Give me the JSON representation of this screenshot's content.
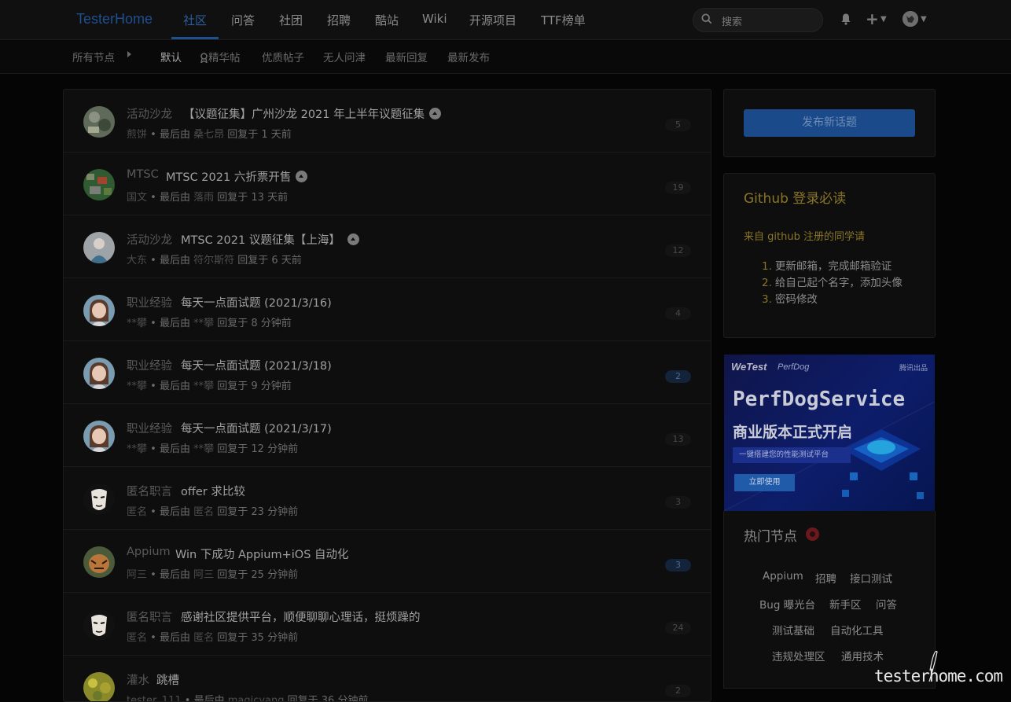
{
  "brand": "TesterHome",
  "nav": [
    "社区",
    "问答",
    "社团",
    "招聘",
    "酷站",
    "Wiki",
    "开源项目",
    "TTF榜单"
  ],
  "search": {
    "placeholder": "搜索"
  },
  "user_menu": {
    "plus": "+"
  },
  "subnav": {
    "all_nodes": "所有节点",
    "tabs": [
      "默认",
      "精华帖",
      "优质帖子",
      "无人问津",
      "最新回复",
      "最新发布"
    ]
  },
  "meta_sep": "• 最后由",
  "topics": [
    {
      "node": "活动沙龙",
      "title": "【议题征集】广州沙龙 2021 年上半年议题征集",
      "author": "煎饼",
      "last_user": "桑七昂",
      "time": "回复于 1 天前",
      "count": "5",
      "pinned": true
    },
    {
      "node": "MTSC",
      "title": "MTSC 2021 六折票开售",
      "author": "国文",
      "last_user": "落雨",
      "time": "回复于 13 天前",
      "count": "19",
      "pinned": true
    },
    {
      "node": "活动沙龙",
      "title": "MTSC 2021 议题征集【上海】",
      "author": "大东",
      "last_user": "符尔斯符",
      "time": "回复于 6 天前",
      "count": "12",
      "pinned": true
    },
    {
      "node": "职业经验",
      "title": "每天一点面试题 (2021/3/16)",
      "author": "**攀",
      "last_user": "**攀",
      "time": "回复于 8 分钟前",
      "count": "4",
      "pinned": false
    },
    {
      "node": "职业经验",
      "title": "每天一点面试题 (2021/3/18)",
      "author": "**攀",
      "last_user": "**攀",
      "time": "回复于 9 分钟前",
      "count": "2",
      "pinned": false,
      "highlight": true
    },
    {
      "node": "职业经验",
      "title": "每天一点面试题 (2021/3/17)",
      "author": "**攀",
      "last_user": "**攀",
      "time": "回复于 12 分钟前",
      "count": "13",
      "pinned": false
    },
    {
      "node": "匿名职言",
      "title": "offer 求比较",
      "author": "匿名",
      "last_user": "匿名",
      "time": "回复于 23 分钟前",
      "count": "3",
      "pinned": false
    },
    {
      "node": "Appium",
      "title": "Win 下成功 Appium+iOS 自动化",
      "author": "阿三",
      "last_user": "阿三",
      "time": "回复于 25 分钟前",
      "count": "3",
      "pinned": false,
      "highlight": true
    },
    {
      "node": "匿名职言",
      "title": "感谢社区提供平台，顺便聊聊心理话，挺烦躁的",
      "author": "匿名",
      "last_user": "匿名",
      "time": "回复于 35 分钟前",
      "count": "24",
      "pinned": false
    },
    {
      "node": "灌水",
      "title": "跳槽",
      "author": "tester_111",
      "last_user": "magicyang",
      "time": "回复于 36 分钟前",
      "count": "2",
      "pinned": false
    }
  ],
  "sidebar": {
    "new_topic": "发布新话题",
    "github": {
      "title": "Github 登录必读",
      "lead": "来自 github 注册的同学请",
      "steps": [
        {
          "num": "1.",
          "text": "更新邮箱，完成邮箱验证"
        },
        {
          "num": "2.",
          "text": "给自己起个名字，添加头像"
        },
        {
          "num": "3.",
          "text": "密码修改"
        }
      ]
    },
    "ad": {
      "brand": "WeTest",
      "brand2": "PerfDog",
      "corner": "腾讯出品",
      "title": "PerfDogService",
      "subtitle": "商业版本正式开启",
      "tagline": "一键搭建您的性能测试平台",
      "button": "立即使用"
    },
    "hot_nodes": {
      "title": "热门节点",
      "rows": [
        [
          "Appium",
          "招聘",
          "接口测试"
        ],
        [
          "Bug 曝光台",
          "新手区",
          "问答"
        ],
        [
          "测试基础",
          "自动化工具"
        ],
        [
          "违规处理区",
          "通用技术"
        ]
      ]
    },
    "watermark": "testerhome.com"
  },
  "colors": {
    "accent": "#1f4f8f",
    "gold": "#8a7526",
    "bg": "#050505"
  }
}
